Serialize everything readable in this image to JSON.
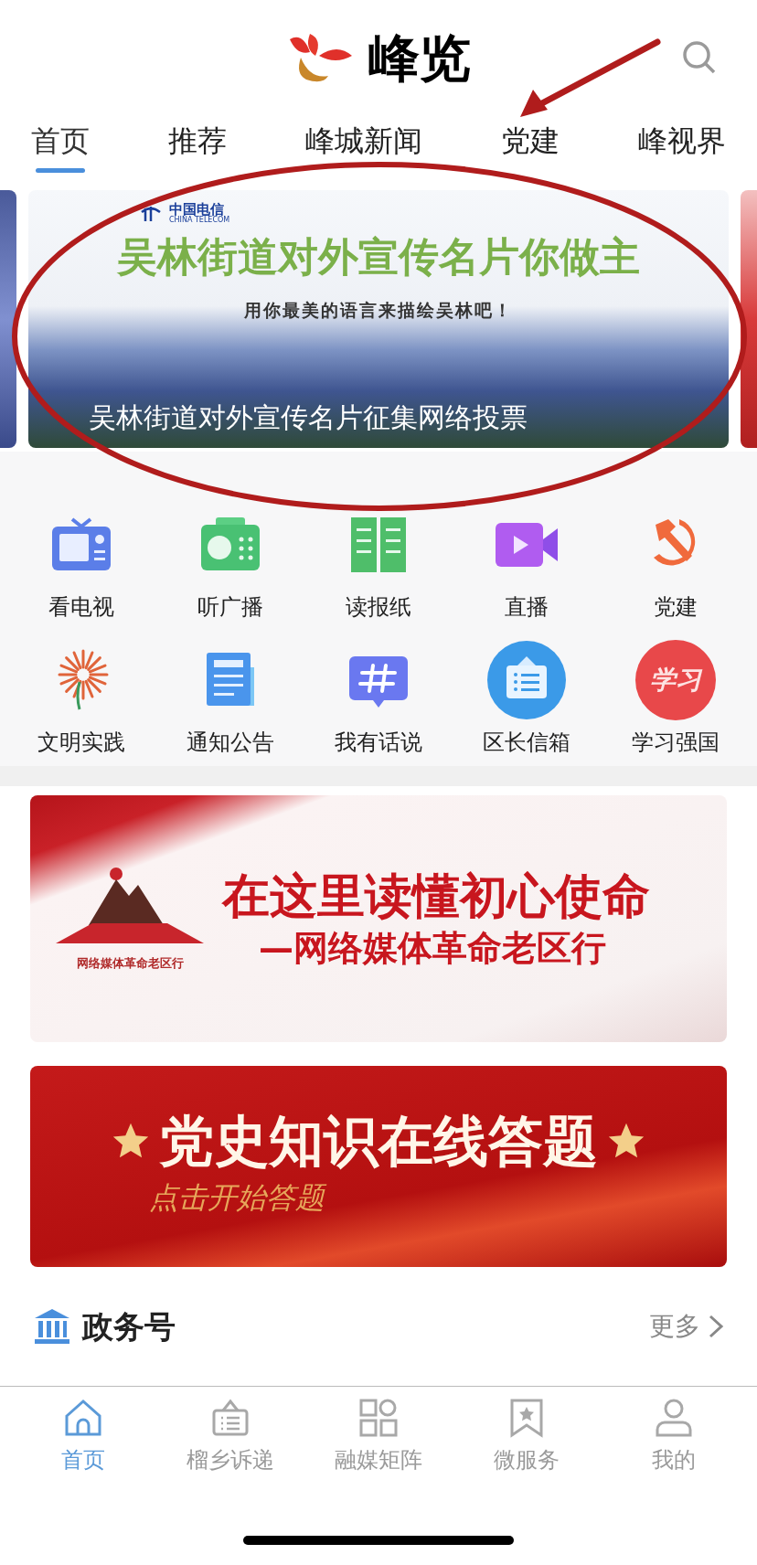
{
  "header": {
    "logo_text": "峰览"
  },
  "tabs": [
    {
      "label": "首页",
      "selected": true
    },
    {
      "label": "推荐",
      "selected": false
    },
    {
      "label": "峰城新闻",
      "selected": false
    },
    {
      "label": "党建",
      "selected": false
    },
    {
      "label": "峰视界",
      "selected": false
    }
  ],
  "carousel": {
    "sponsor": "中国电信",
    "sponsor_en": "CHINA TELECOM",
    "headline": "吴林街道对外宣传名片你做主",
    "tagline": "用你最美的语言来描绘吴林吧！",
    "caption": "吴林街道对外宣传名片征集网络投票"
  },
  "shortcuts": [
    {
      "label": "看电视",
      "kind": "tv"
    },
    {
      "label": "听广播",
      "kind": "radio"
    },
    {
      "label": "读报纸",
      "kind": "newspaper"
    },
    {
      "label": "直播",
      "kind": "live"
    },
    {
      "label": "党建",
      "kind": "party"
    },
    {
      "label": "文明实践",
      "kind": "practice"
    },
    {
      "label": "通知公告",
      "kind": "notice"
    },
    {
      "label": "我有话说",
      "kind": "topic"
    },
    {
      "label": "区长信箱",
      "kind": "mailbox"
    },
    {
      "label": "学习强国",
      "kind": "study",
      "icon_text": "学习"
    }
  ],
  "banners": [
    {
      "kind": "mission",
      "title": "在这里读懂初心使命",
      "subtitle": "—网络媒体革命老区行",
      "logo_caption": "网络媒体革命老区行"
    },
    {
      "kind": "quiz",
      "title": "党史知识在线答题",
      "subtitle": "点击开始答题"
    }
  ],
  "section": {
    "title": "政务号",
    "more": "更多"
  },
  "bottom_nav": [
    {
      "label": "首页",
      "kind": "home",
      "selected": true
    },
    {
      "label": "榴乡诉递",
      "kind": "report",
      "selected": false
    },
    {
      "label": "融媒矩阵",
      "kind": "matrix",
      "selected": false
    },
    {
      "label": "微服务",
      "kind": "service",
      "selected": false
    },
    {
      "label": "我的",
      "kind": "profile",
      "selected": false
    }
  ],
  "annotations": {
    "ellipse_shown": true,
    "arrow_shown": true
  }
}
